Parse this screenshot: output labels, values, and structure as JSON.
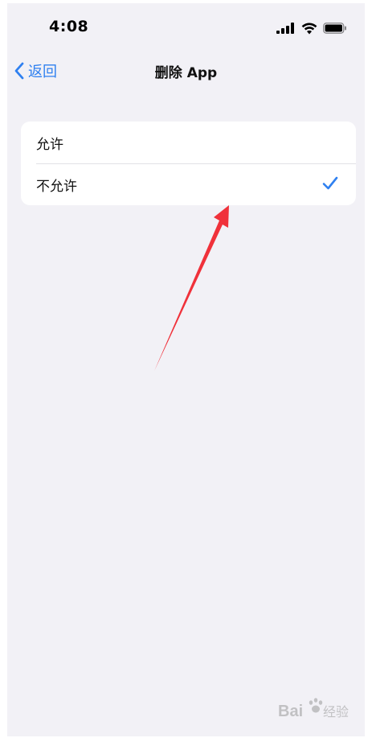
{
  "status_bar": {
    "time": "4:08"
  },
  "nav": {
    "back_label": "返回",
    "title": "删除 App"
  },
  "options": [
    {
      "label": "允许",
      "selected": false
    },
    {
      "label": "不允许",
      "selected": true
    }
  ],
  "icons": {
    "back": "chevron-left-icon",
    "signal": "cellular-signal-icon",
    "wifi": "wifi-icon",
    "battery": "battery-icon",
    "check": "checkmark-icon"
  },
  "colors": {
    "accent": "#2f80f0",
    "background": "#f2f1f6",
    "annotation": "#f0313a"
  },
  "watermark": {
    "text": "Bai 经验"
  }
}
